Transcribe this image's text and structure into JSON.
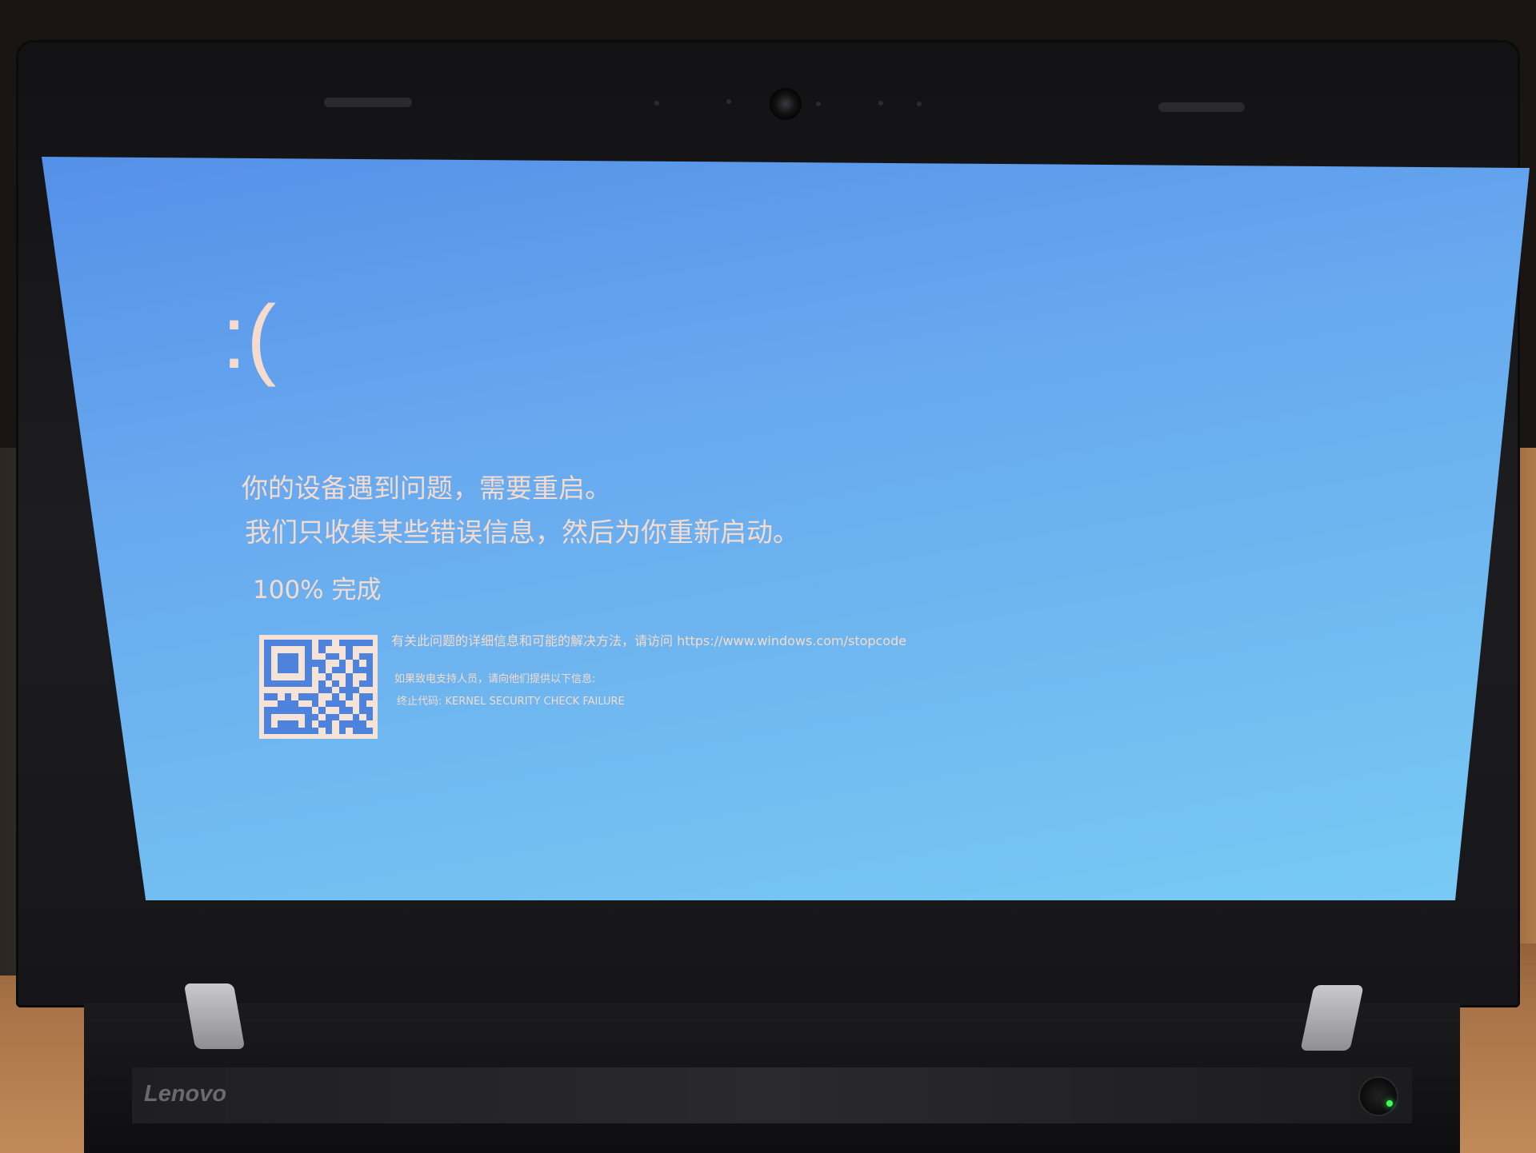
{
  "bsod": {
    "sad_face": ":(",
    "line1": "你的设备遇到问题，需要重启。",
    "line2": "我们只收集某些错误信息，然后为你重新启动。",
    "progress": "100% 完成",
    "progress_value": 100,
    "info_line": "有关此问题的详细信息和可能的解决方法，请访问 https://www.windows.com/stopcode",
    "support_line": "如果致电支持人员，请向他们提供以下信息:",
    "stop_code_line": "终止代码: KERNEL SECURITY CHECK FAILURE"
  },
  "device": {
    "brand": "Lenovo"
  },
  "colors": {
    "screen_blue": "#67a8ef",
    "text": "#f4dbcd",
    "power_led": "#3cff5a"
  }
}
